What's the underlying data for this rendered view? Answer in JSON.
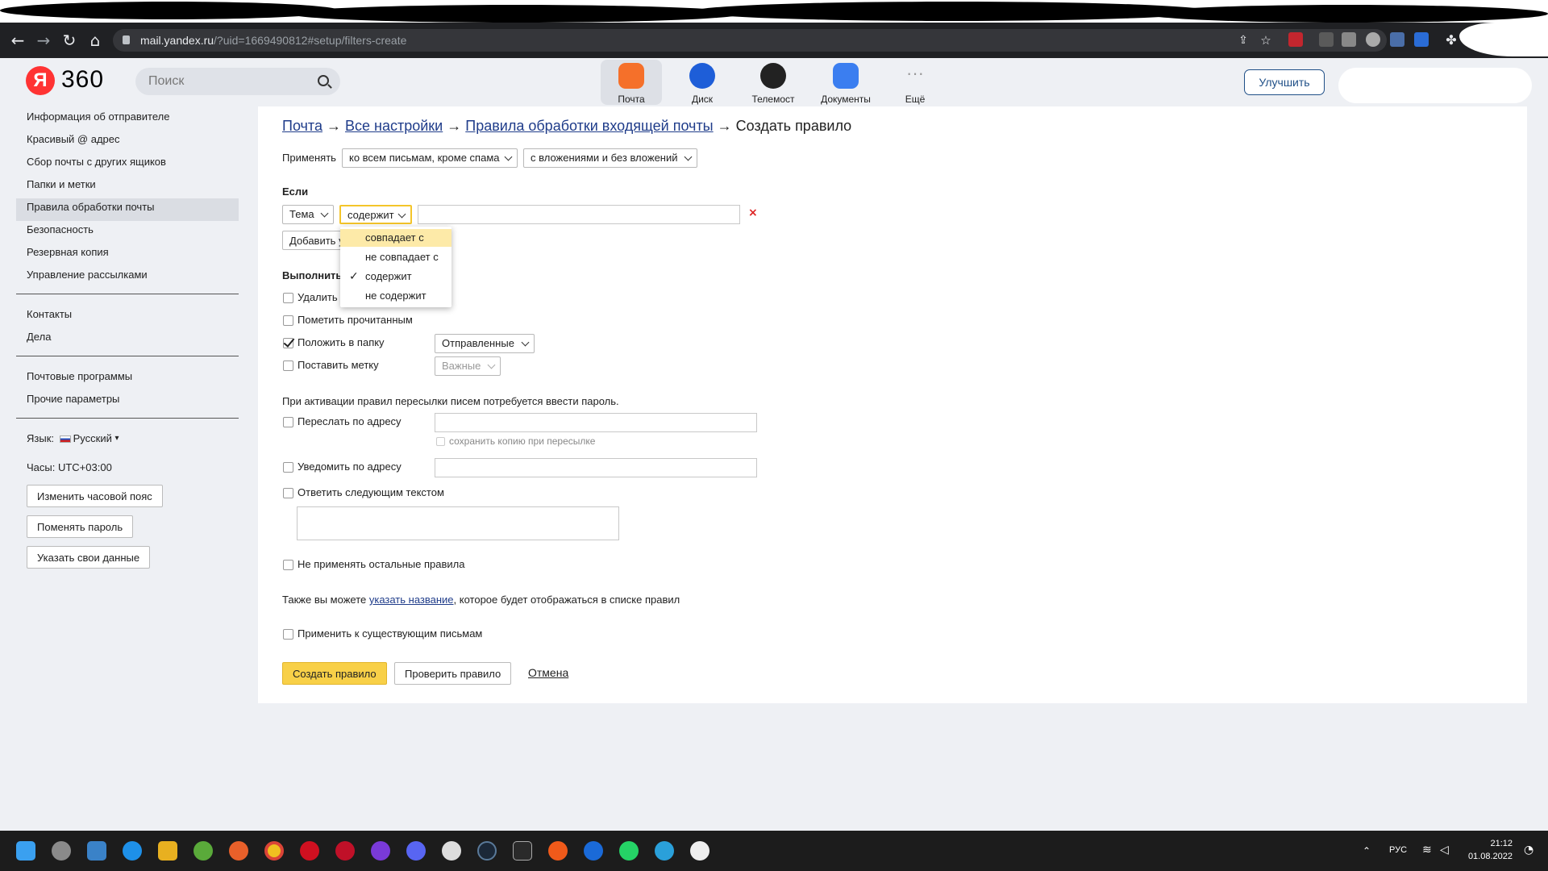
{
  "browser": {
    "url_host": "mail.yandex.ru",
    "url_path": "/?uid=1669490812#setup/filters-create"
  },
  "header": {
    "logo_mark": "Я",
    "logo_text": "360",
    "search_placeholder": "Поиск",
    "services": [
      {
        "label": "Почта",
        "icon": "mail-icon",
        "color": "#f5702a",
        "active": true
      },
      {
        "label": "Диск",
        "icon": "disk-icon",
        "color": "#1e5ed8"
      },
      {
        "label": "Телемост",
        "icon": "telemost-icon",
        "color": "#222222"
      },
      {
        "label": "Документы",
        "icon": "documents-icon",
        "color": "#3b7ef0"
      },
      {
        "label": "Ещё",
        "icon": "more-icon",
        "color": "#aaaaaa"
      }
    ],
    "upgrade_label": "Улучшить"
  },
  "sidebar": {
    "items": [
      {
        "label": "Информация об отправителе"
      },
      {
        "label": "Красивый @ адрес"
      },
      {
        "label": "Сбор почты с других ящиков"
      },
      {
        "label": "Папки и метки"
      },
      {
        "label": "Правила обработки почты",
        "active": true
      },
      {
        "label": "Безопасность"
      },
      {
        "label": "Резервная копия"
      },
      {
        "label": "Управление рассылками"
      }
    ],
    "items2": [
      {
        "label": "Контакты"
      },
      {
        "label": "Дела"
      }
    ],
    "items3": [
      {
        "label": "Почтовые программы"
      },
      {
        "label": "Прочие параметры"
      }
    ],
    "language_label": "Язык:",
    "language_value": "Русский",
    "language_caret": "▾",
    "time_label": "Часы: UTC+03:00",
    "buttons": [
      "Изменить часовой пояс",
      "Поменять пароль",
      "Указать свои данные"
    ]
  },
  "breadcrumbs": {
    "mail": "Почта",
    "arrow": "→",
    "settings": "Все настройки",
    "rules": "Правила обработки входящей почты",
    "current": "Создать правило"
  },
  "form": {
    "apply_label": "Применять",
    "apply_scope": "ко всем письмам, кроме спама",
    "apply_attachments": "с вложениями и без вложений",
    "if_label": "Если",
    "condition_field": "Тема",
    "condition_op": "содержит",
    "condition_value": "",
    "add_condition": "Добавить условие",
    "do_label": "Выполнить действие",
    "actions": {
      "delete": "Удалить",
      "mark_read": "Пометить прочитанным",
      "move_to_folder": "Положить в папку",
      "folder_value": "Отправленные",
      "set_label": "Поставить метку",
      "label_value": "Важные"
    },
    "forward_note": "При активации правил пересылки писем потребуется ввести пароль.",
    "forward_label": "Переслать по адресу",
    "forward_value": "",
    "keep_copy": "сохранить копию при пересылке",
    "notify_label": "Уведомить по адресу",
    "notify_value": "",
    "reply_label": "Ответить следующим текстом",
    "reply_value": "",
    "stop_rules": "Не применять остальные правила",
    "name_hint_prefix": "Также вы можете ",
    "name_hint_link": "указать название",
    "name_hint_suffix": ", которое будет отображаться в списке правил",
    "apply_existing": "Применить к существующим письмам",
    "create_btn": "Создать правило",
    "check_btn": "Проверить правило",
    "cancel": "Отмена"
  },
  "dropdown": {
    "options": [
      {
        "label": "совпадает с",
        "highlighted": true
      },
      {
        "label": "не совпадает с"
      },
      {
        "label": "содержит",
        "checked": true
      },
      {
        "label": "не содержит"
      }
    ],
    "check_mark": "✓"
  },
  "taskbar": {
    "lang": "РУС",
    "time": "21:12",
    "date": "01.08.2022"
  }
}
